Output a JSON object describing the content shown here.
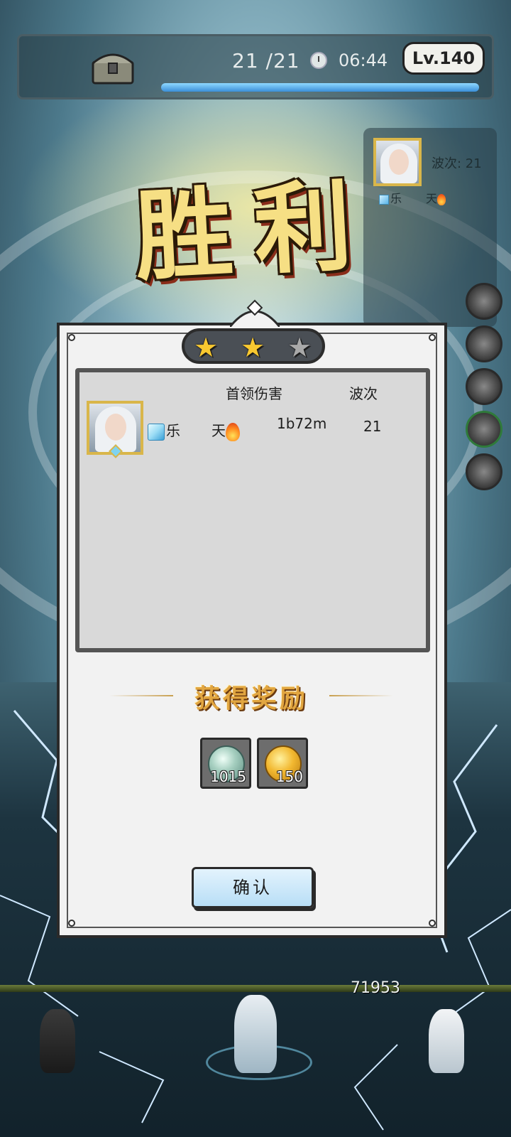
{
  "hud": {
    "wave_count": "21 /21",
    "timer": "06:44",
    "level": "Lv.140",
    "icons": [
      "chest-icon",
      "clock-icon"
    ]
  },
  "side_panel": {
    "wave_label": "波次: 21",
    "name_left": "乐",
    "name_right": "天"
  },
  "victory": {
    "title": "胜利",
    "stars_earned": 2,
    "stars_total": 3
  },
  "stats": {
    "headers": {
      "boss_damage": "首领伤害",
      "waves": "波次"
    },
    "rows": [
      {
        "name_left": "乐",
        "name_right": "天",
        "boss_damage": "1b72m",
        "waves": "21"
      }
    ]
  },
  "rewards": {
    "title": "获得奖励",
    "items": [
      {
        "icon": "silver-coin-icon",
        "count": "1015"
      },
      {
        "icon": "gold-coin-icon",
        "count": "150"
      }
    ]
  },
  "confirm_label": "确认",
  "battlefield": {
    "power_value": "71953"
  },
  "colors": {
    "victory_gold": "#f6df84",
    "reward_title": "#e2a640",
    "confirm_button": "#b8def6",
    "star_gold": "#f8c830",
    "star_grey": "#a9a9a9"
  }
}
